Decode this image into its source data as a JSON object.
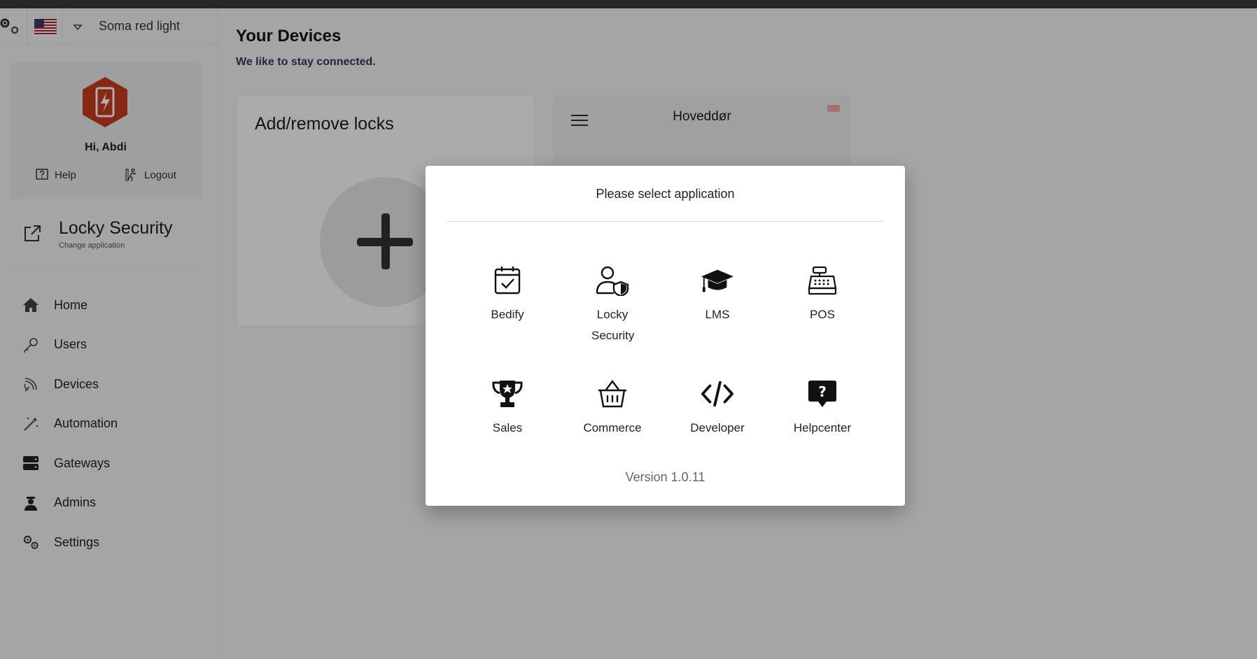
{
  "header": {
    "workspace_name": "Soma red light",
    "language_flag": "us-flag-icon"
  },
  "profile": {
    "greeting": "Hi, Abdi",
    "help_label": "Help",
    "logout_label": "Logout"
  },
  "app_switcher": {
    "name": "Locky Security",
    "subtitle": "Change application"
  },
  "nav": {
    "items": [
      {
        "label": "Home",
        "icon": "home-icon"
      },
      {
        "label": "Users",
        "icon": "key-icon"
      },
      {
        "label": "Devices",
        "icon": "signal-icon"
      },
      {
        "label": "Automation",
        "icon": "magic-wand-icon"
      },
      {
        "label": "Gateways",
        "icon": "server-icon"
      },
      {
        "label": "Admins",
        "icon": "admin-icon"
      },
      {
        "label": "Settings",
        "icon": "gears-icon"
      }
    ]
  },
  "main": {
    "title": "Your Devices",
    "subtitle": "We like to stay connected.",
    "add_card_title": "Add/remove locks",
    "door_card_title": "Hoveddør"
  },
  "modal": {
    "title": "Please select application",
    "apps": [
      {
        "label": "Bedify",
        "icon": "calendar-check-icon"
      },
      {
        "label": "Locky Security",
        "icon": "user-shield-icon"
      },
      {
        "label": "LMS",
        "icon": "graduation-cap-icon"
      },
      {
        "label": "POS",
        "icon": "cash-register-icon"
      },
      {
        "label": "Sales",
        "icon": "trophy-icon"
      },
      {
        "label": "Commerce",
        "icon": "basket-icon"
      },
      {
        "label": "Developer",
        "icon": "code-icon"
      },
      {
        "label": "Helpcenter",
        "icon": "question-chat-icon"
      }
    ],
    "version": "Version 1.0.11"
  },
  "colors": {
    "logo_red": "#c93a1e",
    "accent_navy": "#34395a",
    "overlay": "#000000"
  }
}
